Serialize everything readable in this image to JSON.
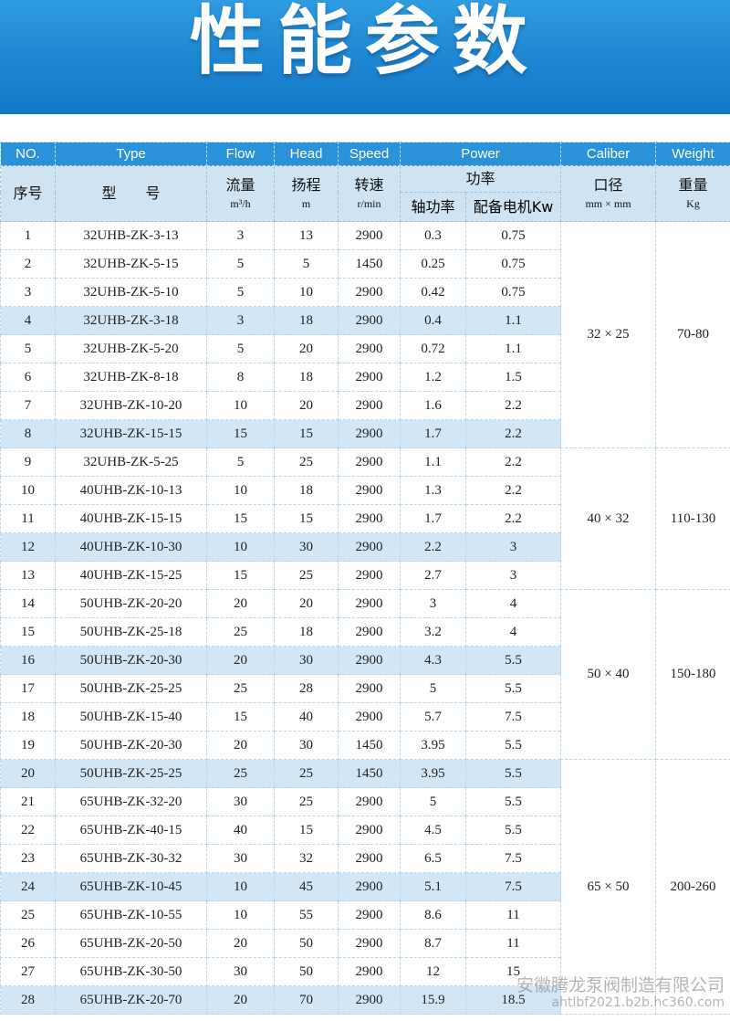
{
  "banner": {
    "title": "性能参数"
  },
  "header_en": {
    "no": "NO.",
    "type": "Type",
    "flow": "Flow",
    "head": "Head",
    "speed": "Speed",
    "power": "Power",
    "caliber": "Caliber",
    "weight": "Weight"
  },
  "header_zh": {
    "no": "序号",
    "type": "型　　号",
    "flow": "流量",
    "flow_unit": "m³/h",
    "head": "扬程",
    "head_unit": "m",
    "speed": "转速",
    "speed_unit": "r/min",
    "power": "功率",
    "shaft_power": "轴功率",
    "motor_power": "配备电机Kw",
    "caliber": "口径",
    "caliber_unit": "mm × mm",
    "weight": "重量",
    "weight_unit": "Kg"
  },
  "rows": [
    {
      "no": "1",
      "type": "32UHB-ZK-3-13",
      "flow": "3",
      "head": "13",
      "speed": "2900",
      "shaft": "0.3",
      "motor": "0.75",
      "highlight": false
    },
    {
      "no": "2",
      "type": "32UHB-ZK-5-15",
      "flow": "5",
      "head": "5",
      "speed": "1450",
      "shaft": "0.25",
      "motor": "0.75",
      "highlight": false
    },
    {
      "no": "3",
      "type": "32UHB-ZK-5-10",
      "flow": "5",
      "head": "10",
      "speed": "2900",
      "shaft": "0.42",
      "motor": "0.75",
      "highlight": false
    },
    {
      "no": "4",
      "type": "32UHB-ZK-3-18",
      "flow": "3",
      "head": "18",
      "speed": "2900",
      "shaft": "0.4",
      "motor": "1.1",
      "highlight": true
    },
    {
      "no": "5",
      "type": "32UHB-ZK-5-20",
      "flow": "5",
      "head": "20",
      "speed": "2900",
      "shaft": "0.72",
      "motor": "1.1",
      "highlight": false
    },
    {
      "no": "6",
      "type": "32UHB-ZK-8-18",
      "flow": "8",
      "head": "18",
      "speed": "2900",
      "shaft": "1.2",
      "motor": "1.5",
      "highlight": false
    },
    {
      "no": "7",
      "type": "32UHB-ZK-10-20",
      "flow": "10",
      "head": "20",
      "speed": "2900",
      "shaft": "1.6",
      "motor": "2.2",
      "highlight": false
    },
    {
      "no": "8",
      "type": "32UHB-ZK-15-15",
      "flow": "15",
      "head": "15",
      "speed": "2900",
      "shaft": "1.7",
      "motor": "2.2",
      "highlight": true
    },
    {
      "no": "9",
      "type": "32UHB-ZK-5-25",
      "flow": "5",
      "head": "25",
      "speed": "2900",
      "shaft": "1.1",
      "motor": "2.2",
      "highlight": false
    },
    {
      "no": "10",
      "type": "40UHB-ZK-10-13",
      "flow": "10",
      "head": "18",
      "speed": "2900",
      "shaft": "1.3",
      "motor": "2.2",
      "highlight": false
    },
    {
      "no": "11",
      "type": "40UHB-ZK-15-15",
      "flow": "15",
      "head": "15",
      "speed": "2900",
      "shaft": "1.7",
      "motor": "2.2",
      "highlight": false
    },
    {
      "no": "12",
      "type": "40UHB-ZK-10-30",
      "flow": "10",
      "head": "30",
      "speed": "2900",
      "shaft": "2.2",
      "motor": "3",
      "highlight": true
    },
    {
      "no": "13",
      "type": "40UHB-ZK-15-25",
      "flow": "15",
      "head": "25",
      "speed": "2900",
      "shaft": "2.7",
      "motor": "3",
      "highlight": false
    },
    {
      "no": "14",
      "type": "50UHB-ZK-20-20",
      "flow": "20",
      "head": "20",
      "speed": "2900",
      "shaft": "3",
      "motor": "4",
      "highlight": false
    },
    {
      "no": "15",
      "type": "50UHB-ZK-25-18",
      "flow": "25",
      "head": "18",
      "speed": "2900",
      "shaft": "3.2",
      "motor": "4",
      "highlight": false
    },
    {
      "no": "16",
      "type": "50UHB-ZK-20-30",
      "flow": "20",
      "head": "30",
      "speed": "2900",
      "shaft": "4.3",
      "motor": "5.5",
      "highlight": true
    },
    {
      "no": "17",
      "type": "50UHB-ZK-25-25",
      "flow": "25",
      "head": "28",
      "speed": "2900",
      "shaft": "5",
      "motor": "5.5",
      "highlight": false
    },
    {
      "no": "18",
      "type": "50UHB-ZK-15-40",
      "flow": "15",
      "head": "40",
      "speed": "2900",
      "shaft": "5.7",
      "motor": "7.5",
      "highlight": false
    },
    {
      "no": "19",
      "type": "50UHB-ZK-20-30",
      "flow": "20",
      "head": "30",
      "speed": "1450",
      "shaft": "3.95",
      "motor": "5.5",
      "highlight": false
    },
    {
      "no": "20",
      "type": "50UHB-ZK-25-25",
      "flow": "25",
      "head": "25",
      "speed": "1450",
      "shaft": "3.95",
      "motor": "5.5",
      "highlight": true
    },
    {
      "no": "21",
      "type": "65UHB-ZK-32-20",
      "flow": "30",
      "head": "25",
      "speed": "2900",
      "shaft": "5",
      "motor": "5.5",
      "highlight": false
    },
    {
      "no": "22",
      "type": "65UHB-ZK-40-15",
      "flow": "40",
      "head": "15",
      "speed": "2900",
      "shaft": "4.5",
      "motor": "5.5",
      "highlight": false
    },
    {
      "no": "23",
      "type": "65UHB-ZK-30-32",
      "flow": "30",
      "head": "32",
      "speed": "2900",
      "shaft": "6.5",
      "motor": "7.5",
      "highlight": false
    },
    {
      "no": "24",
      "type": "65UHB-ZK-10-45",
      "flow": "10",
      "head": "45",
      "speed": "2900",
      "shaft": "5.1",
      "motor": "7.5",
      "highlight": true
    },
    {
      "no": "25",
      "type": "65UHB-ZK-10-55",
      "flow": "10",
      "head": "55",
      "speed": "2900",
      "shaft": "8.6",
      "motor": "11",
      "highlight": false
    },
    {
      "no": "26",
      "type": "65UHB-ZK-20-50",
      "flow": "20",
      "head": "50",
      "speed": "2900",
      "shaft": "8.7",
      "motor": "11",
      "highlight": false
    },
    {
      "no": "27",
      "type": "65UHB-ZK-30-50",
      "flow": "30",
      "head": "50",
      "speed": "2900",
      "shaft": "12",
      "motor": "15",
      "highlight": false
    },
    {
      "no": "28",
      "type": "65UHB-ZK-20-70",
      "flow": "20",
      "head": "70",
      "speed": "2900",
      "shaft": "15.9",
      "motor": "18.5",
      "highlight": true
    }
  ],
  "groups": [
    {
      "caliber": "32 × 25",
      "weight": "70-80",
      "count": 8
    },
    {
      "caliber": "40 × 32",
      "weight": "110-130",
      "count": 5
    },
    {
      "caliber": "50 × 40",
      "weight": "150-180",
      "count": 6
    },
    {
      "caliber": "65 × 50",
      "weight": "200-260",
      "count": 9
    }
  ],
  "watermark": {
    "company": "安徽腾龙泵阀制造有限公司",
    "url": "ahtlbf2021.b2b.hc360.com"
  }
}
